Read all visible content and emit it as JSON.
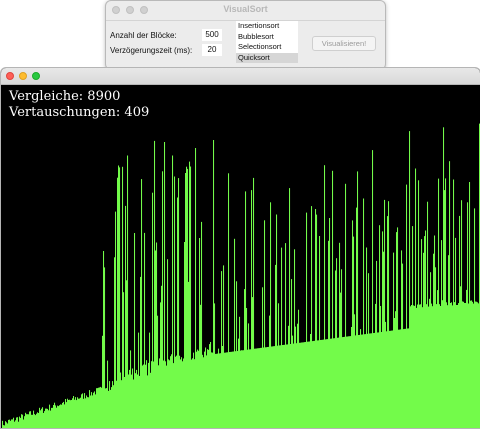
{
  "control_window": {
    "title": "VisualSort",
    "block_count_label": "Anzahl der Blöcke:",
    "block_count_value": "500",
    "delay_label": "Verzögerungszeit (ms):",
    "delay_value": "20",
    "algorithms": [
      "Insertionsort",
      "Bubblesort",
      "Selectionsort",
      "Quicksort"
    ],
    "selected_algorithm": "Quicksort",
    "visualize_button": "Visualisieren!"
  },
  "visualization_window": {
    "comparisons": "Vergleiche: 8900",
    "swaps": "Vertauschungen: 409",
    "bar_color": "#73fb4a",
    "background_color": "#000000",
    "block_count": 500,
    "max_value": 500,
    "segments": [
      {
        "from": 0,
        "to": 101,
        "base_from": 0,
        "base_to": 101,
        "spread": 0.06
      },
      {
        "from": 101,
        "to": 214,
        "base_from": 101,
        "base_to": 214,
        "spread": 0.12
      },
      {
        "from": 214,
        "to": 408,
        "base_from": 214,
        "base_to": 288,
        "spread": 0.0
      },
      {
        "from": 408,
        "to": 479,
        "base_from": 345,
        "base_to": 360,
        "spread": 0.03
      }
    ]
  }
}
